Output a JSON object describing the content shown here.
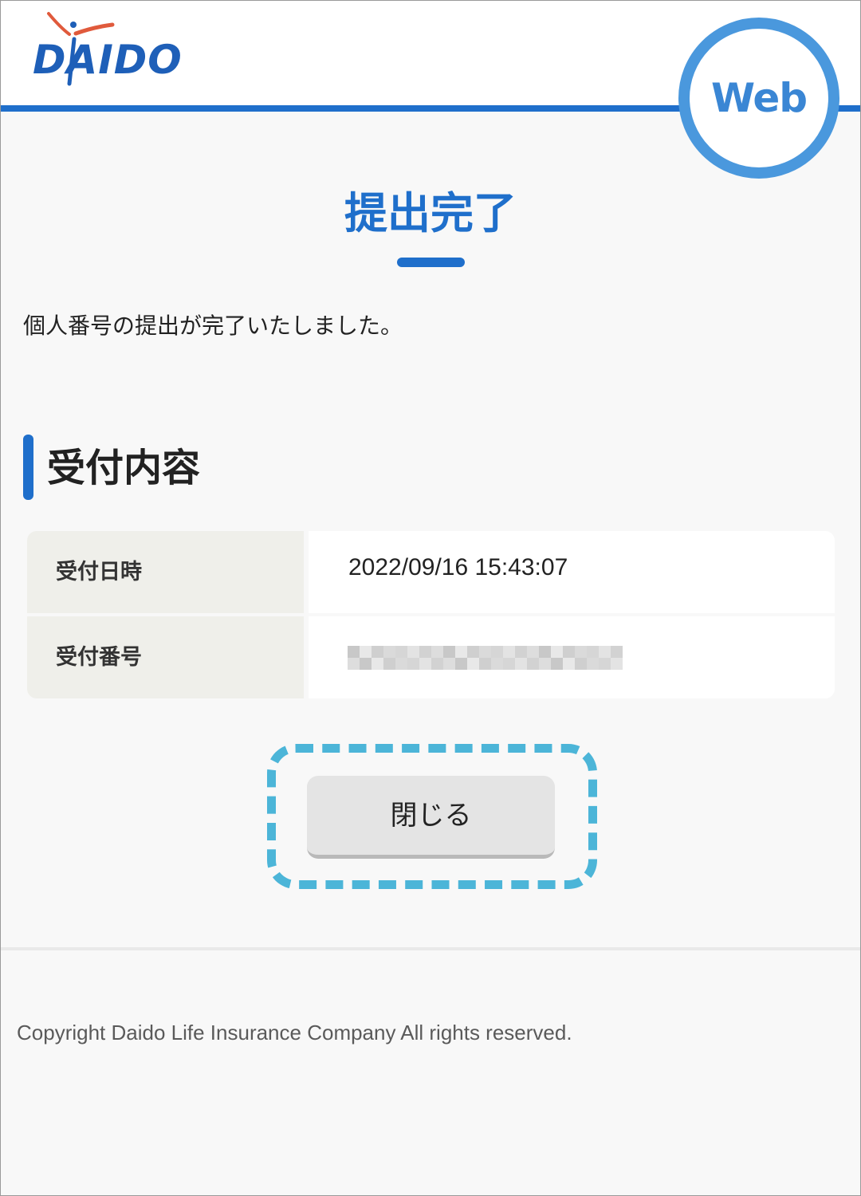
{
  "brand": {
    "logo_text": "DAIDO",
    "badge_text": "Web",
    "primary_color": "#1f6fcb",
    "badge_color": "#4a98dd",
    "logo_accent_color": "#e05a3c"
  },
  "page": {
    "title": "提出完了",
    "message": "個人番号の提出が完了いたしました。"
  },
  "section": {
    "title": "受付内容"
  },
  "details": {
    "rows": [
      {
        "label": "受付日時",
        "value": "2022/09/16 15:43:07"
      },
      {
        "label": "受付番号",
        "value": ""
      }
    ],
    "redacted_number_icon": "mosaic-redaction"
  },
  "actions": {
    "close_label": "閉じる",
    "focus_ring_color": "#4cb5d8"
  },
  "footer": {
    "copyright": "Copyright Daido Life Insurance Company All rights reserved."
  }
}
